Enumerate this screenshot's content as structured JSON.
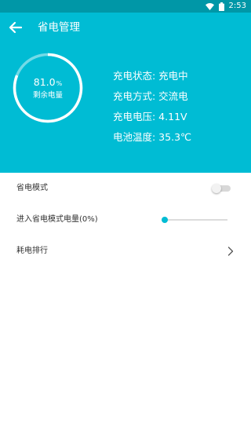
{
  "status_bar": {
    "time": "2:53"
  },
  "app_bar": {
    "title": "省电管理"
  },
  "battery": {
    "level_text": "81.0",
    "level_unit": "%",
    "level_fraction": 0.81,
    "caption": "剩余电量"
  },
  "info": [
    "充电状态: 充电中",
    "充电方式: 交流电",
    "充电电压: 4.11V",
    "电池温度: 35.3℃"
  ],
  "settings": {
    "power_saving_mode": {
      "label": "省电模式",
      "enabled": false
    },
    "threshold": {
      "label": "进入省电模式电量(0%)",
      "value_percent": 0
    },
    "ranking": {
      "label": "耗电排行"
    }
  },
  "colors": {
    "header_bg": "#00bcd4",
    "status_bar_bg": "#0097a7",
    "accent": "#00bcd4"
  }
}
